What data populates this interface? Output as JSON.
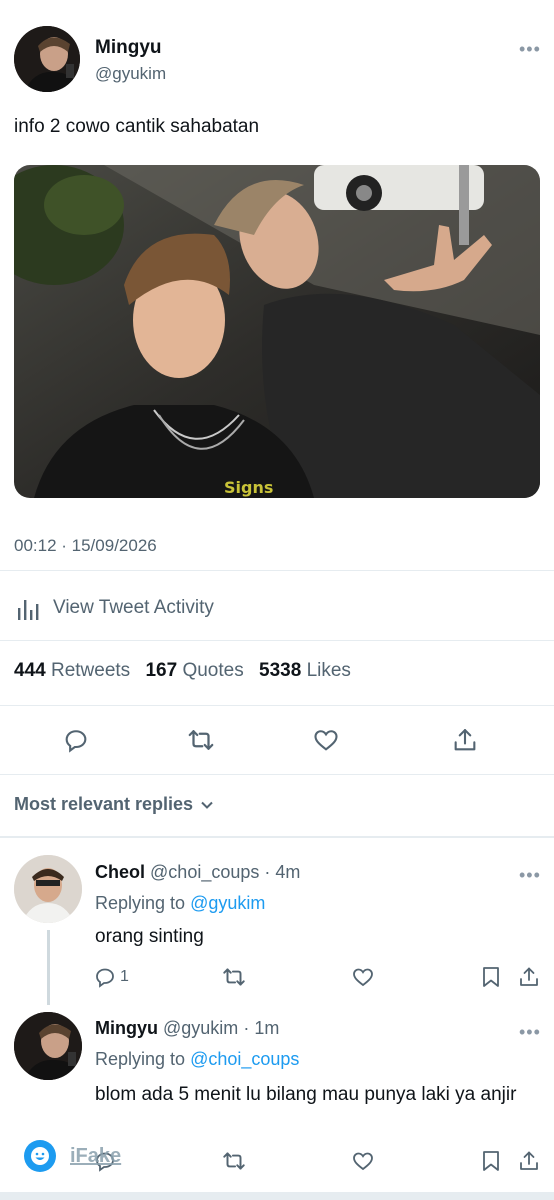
{
  "tweet": {
    "author_name": "Mingyu",
    "author_handle": "@gyukim",
    "text": "info 2 cowo cantik sahabatan",
    "timestamp": "00:12 · 15/09/2026",
    "view_activity": "View Tweet Activity",
    "stats": {
      "retweets_count": "444",
      "retweets_label": "Retweets",
      "quotes_count": "167",
      "quotes_label": "Quotes",
      "likes_count": "5338",
      "likes_label": "Likes"
    },
    "photo_caption_text": "Signs"
  },
  "replies_sort_label": "Most relevant replies",
  "replies": [
    {
      "name": "Cheol",
      "handle": "@choi_coups",
      "time": "· 4m",
      "replying_prefix": "Replying to",
      "replying_to": "@gyukim",
      "text": "orang sinting",
      "reply_count": "1"
    },
    {
      "name": "Mingyu",
      "handle": "@gyukim",
      "time": "· 1m",
      "replying_prefix": "Replying to",
      "replying_to": "@choi_coups",
      "text": "blom ada 5 menit lu bilang mau punya laki ya anjir"
    }
  ],
  "watermark": "iFake",
  "colors": {
    "accent": "#1d9bf0",
    "muted": "#536471",
    "text": "#0f1419",
    "divider": "#e6ecf0"
  }
}
